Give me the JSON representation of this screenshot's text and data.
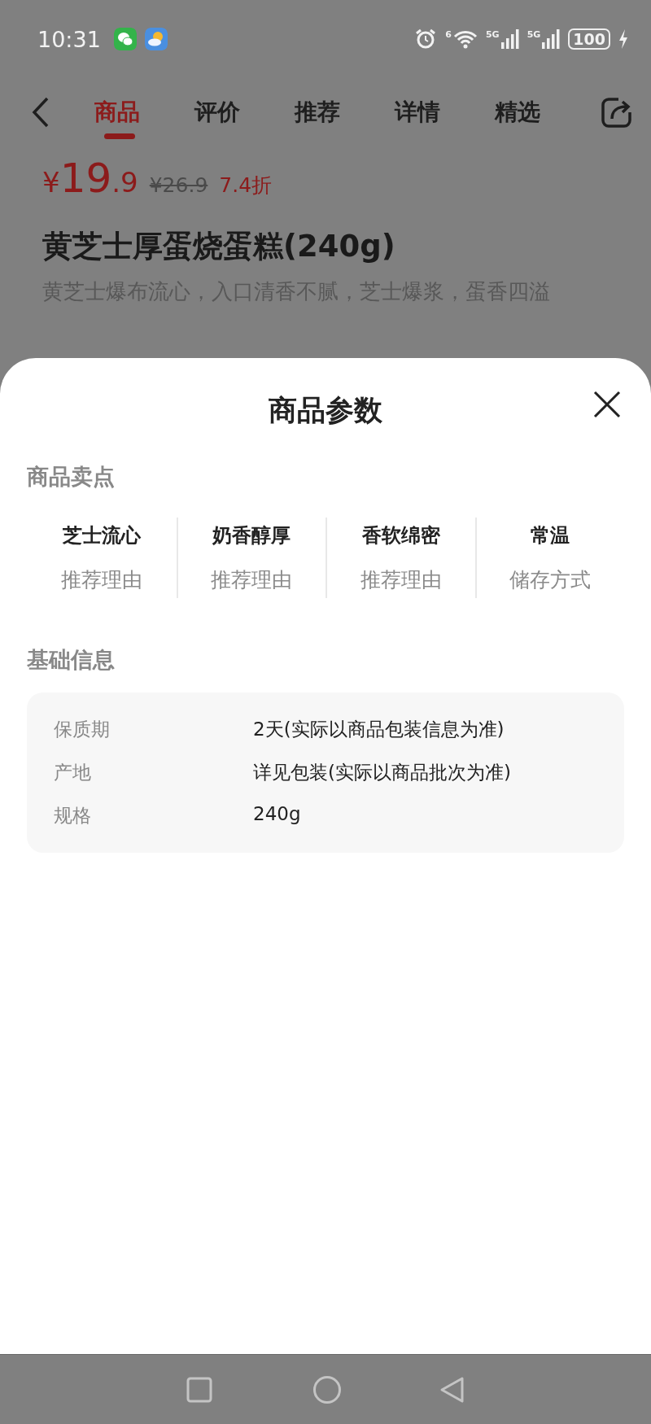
{
  "status_bar": {
    "time": "10:31",
    "wifi_label": "6",
    "signal_labels": [
      "5G",
      "5G"
    ],
    "battery": "100"
  },
  "tabs": [
    {
      "label": "商品",
      "selected": true
    },
    {
      "label": "评价",
      "selected": false
    },
    {
      "label": "推荐",
      "selected": false
    },
    {
      "label": "详情",
      "selected": false
    },
    {
      "label": "精选",
      "selected": false
    }
  ],
  "product": {
    "currency": "¥",
    "price_integer": "19",
    "price_decimal": ".9",
    "original_price": "¥26.9",
    "discount": "7.4折",
    "title": "黄芝士厚蛋烧蛋糕(240g)",
    "subtitle": "黄芝士爆布流心，入口清香不腻，芝士爆浆，蛋香四溢"
  },
  "sheet": {
    "title": "商品参数",
    "selling_points_heading": "商品卖点",
    "selling_points": [
      {
        "value": "芝士流心",
        "label": "推荐理由"
      },
      {
        "value": "奶香醇厚",
        "label": "推荐理由"
      },
      {
        "value": "香软绵密",
        "label": "推荐理由"
      },
      {
        "value": "常温",
        "label": "储存方式"
      }
    ],
    "basic_info_heading": "基础信息",
    "basic_info": [
      {
        "label": "保质期",
        "value": "2天(实际以商品包装信息为准)"
      },
      {
        "label": "产地",
        "value": "详见包装(实际以商品批次为准)"
      },
      {
        "label": "规格",
        "value": "240g"
      }
    ]
  }
}
